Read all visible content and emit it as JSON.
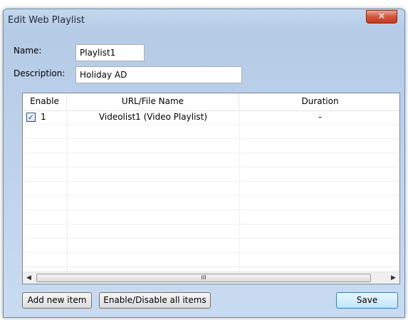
{
  "window": {
    "title": "Edit Web Playlist",
    "close_glyph": "✕"
  },
  "form": {
    "name_label": "Name:",
    "name_value": "Playlist1",
    "description_label": "Description:",
    "description_value": "Holiday AD"
  },
  "table": {
    "columns": [
      "Enable",
      "URL/File Name",
      "Duration"
    ],
    "rows": [
      {
        "checked": true,
        "index": "1",
        "url": "Videolist1 (Video Playlist)",
        "duration": "-"
      }
    ]
  },
  "scrollbar": {
    "left_arrow": "◀",
    "right_arrow": "▶",
    "thumb_grip": "III"
  },
  "buttons": {
    "add": "Add new item",
    "toggle_all": "Enable/Disable all items",
    "save": "Save"
  }
}
